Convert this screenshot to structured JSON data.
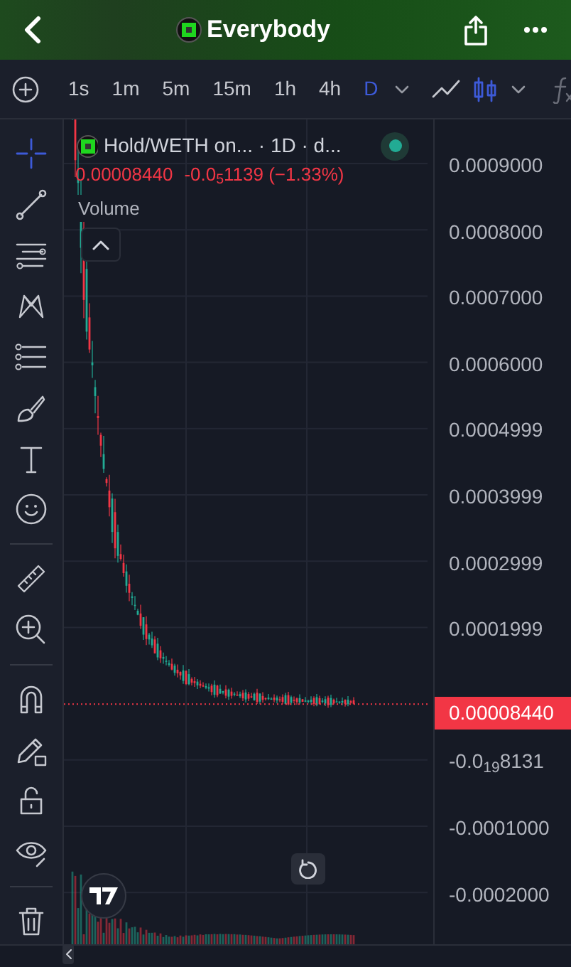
{
  "header": {
    "title": "Everybody"
  },
  "toolbar": {
    "timeframes": [
      {
        "label": "1s",
        "selected": false
      },
      {
        "label": "1m",
        "selected": false
      },
      {
        "label": "5m",
        "selected": false
      },
      {
        "label": "15m",
        "selected": false
      },
      {
        "label": "1h",
        "selected": false
      },
      {
        "label": "4h",
        "selected": false
      },
      {
        "label": "D",
        "selected": true
      }
    ],
    "chart_types": [
      {
        "kind": "line",
        "selected": false
      },
      {
        "kind": "candles",
        "selected": true
      }
    ]
  },
  "drawing_tools": [
    [
      {
        "kind": "crosshair",
        "selected": true
      },
      {
        "kind": "trend-line",
        "selected": false
      },
      {
        "kind": "lines",
        "selected": false
      },
      {
        "kind": "pattern",
        "selected": false
      },
      {
        "kind": "fib",
        "selected": false
      },
      {
        "kind": "brush",
        "selected": false
      },
      {
        "kind": "text",
        "selected": false
      },
      {
        "kind": "emoji",
        "selected": false
      }
    ],
    [
      {
        "kind": "ruler",
        "selected": false
      },
      {
        "kind": "zoom",
        "selected": false
      }
    ],
    [
      {
        "kind": "magnet",
        "selected": false
      },
      {
        "kind": "pencil-lock",
        "selected": false
      },
      {
        "kind": "lock",
        "selected": false
      },
      {
        "kind": "eye",
        "selected": false
      }
    ],
    [
      {
        "kind": "trash",
        "selected": false
      }
    ]
  ],
  "legend": {
    "symbol": "Hold/WETH on... · 1D · d...",
    "live": true,
    "price": "0.00008440",
    "change": "-0.0$_{5}$1139 (−1.33%)",
    "volume_label": "Volume"
  },
  "price_axis": {
    "labels": [
      {
        "kind": "tick",
        "text": "0.0009000"
      },
      {
        "kind": "tick",
        "text": "0.0008000"
      },
      {
        "kind": "tick",
        "text": "0.0007000"
      },
      {
        "kind": "tick",
        "text": "0.0006000"
      },
      {
        "kind": "tick",
        "text": "0.0004999"
      },
      {
        "kind": "tick",
        "text": "0.0003999"
      },
      {
        "kind": "tick",
        "text": "0.0002999"
      },
      {
        "kind": "tick",
        "text": "0.0001999"
      },
      {
        "kind": "current",
        "text": "0.00008440"
      },
      {
        "kind": "tick",
        "text": "-0.0$_{19}$8131"
      },
      {
        "kind": "tick",
        "text": "-0.0001000"
      },
      {
        "kind": "tick",
        "text": "-0.0002000"
      }
    ]
  }
}
